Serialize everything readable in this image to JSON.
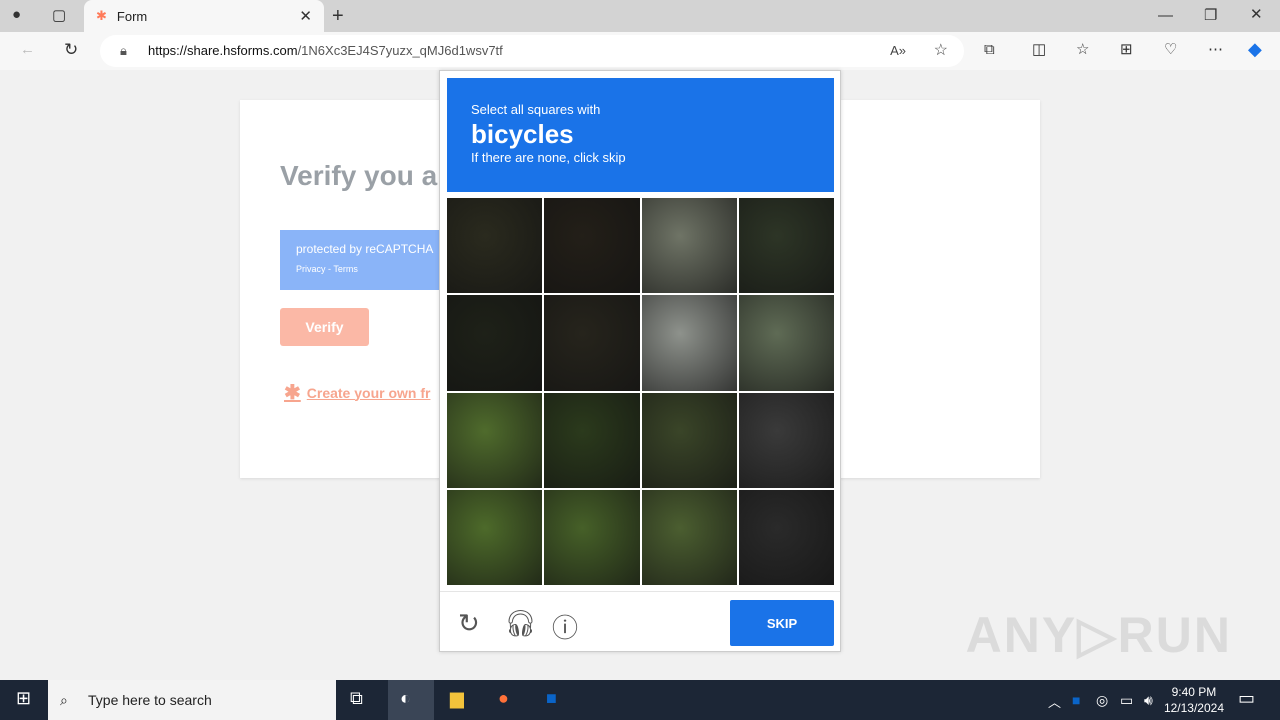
{
  "browser": {
    "tab_title": "Form",
    "url_host": "https://share.hsforms.com",
    "url_path": "/1N6Xc3EJ4S7yuzx_qMJ6d1wsv7tf"
  },
  "form": {
    "title": "Verify you a",
    "recaptcha_text": "protected by reCAPTCHA",
    "recaptcha_links": "Privacy - Terms",
    "verify_label": "Verify",
    "create_link": "Create your own fr"
  },
  "captcha": {
    "instruction": "Select all squares with",
    "target": "bicycles",
    "hint": "If there are none, click skip",
    "skip_label": "SKIP",
    "tiles": [
      "#2a2a1e",
      "#231f18",
      "#6f7466",
      "#2d3526",
      "#1e2118",
      "#26241c",
      "#8e928c",
      "#5f6b55",
      "#4f6b2c",
      "#2b3a1c",
      "#3a4528",
      "#3a3a3a",
      "#4d6a2a",
      "#466028",
      "#4b5e30",
      "#2a2a2a"
    ]
  },
  "taskbar": {
    "search_placeholder": "Type here to search",
    "time": "9:40 PM",
    "date": "12/13/2024"
  },
  "watermark": "ANY RUN"
}
